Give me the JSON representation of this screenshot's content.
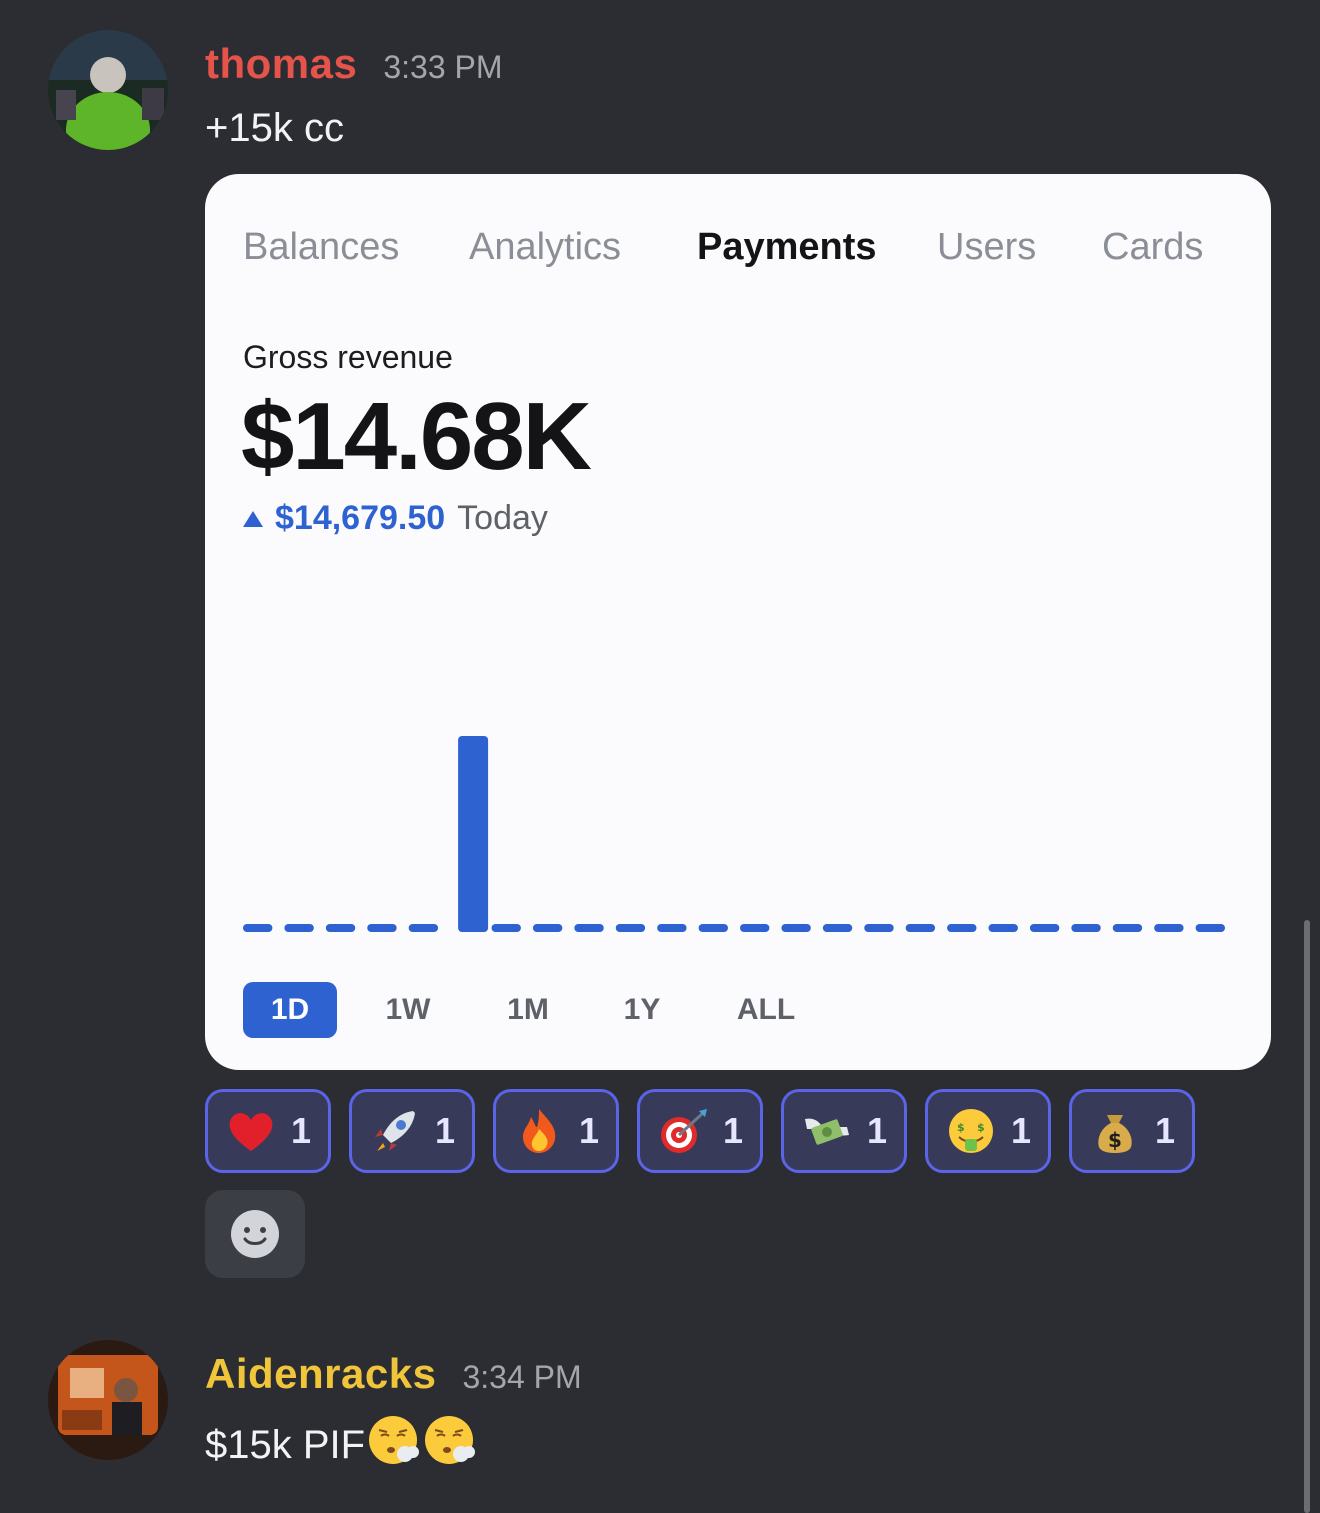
{
  "messages": [
    {
      "username": "thomas",
      "username_color": "#e5544a",
      "time": "3:33 PM",
      "text": "+15k cc",
      "attachment": {
        "tabs": [
          "Balances",
          "Analytics",
          "Payments",
          "Users",
          "Cards"
        ],
        "active_tab": "Payments",
        "metric_label": "Gross revenue",
        "metric_value": "$14.68K",
        "delta_value": "$14,679.50",
        "delta_period": "Today",
        "ranges": [
          "1D",
          "1W",
          "1M",
          "1Y",
          "ALL"
        ],
        "active_range": "1D"
      },
      "reactions": [
        {
          "emoji": "red-heart",
          "count": "1"
        },
        {
          "emoji": "rocket",
          "count": "1"
        },
        {
          "emoji": "fire",
          "count": "1"
        },
        {
          "emoji": "direct-hit",
          "count": "1"
        },
        {
          "emoji": "money-with-wings",
          "count": "1"
        },
        {
          "emoji": "money-mouth-face",
          "count": "1"
        },
        {
          "emoji": "money-bag",
          "count": "1"
        }
      ]
    },
    {
      "username": "Aidenracks",
      "username_color": "#f0c53a",
      "time": "3:34 PM",
      "text": "$15k PIF",
      "trailing_emojis": [
        "face-exhaling",
        "face-exhaling"
      ]
    }
  ],
  "chart_data": {
    "type": "bar",
    "series": [
      {
        "values": [
          0,
          0,
          0,
          0,
          0,
          14679.5,
          0,
          0,
          0,
          0,
          0,
          0,
          0,
          0,
          0,
          0,
          0,
          0,
          0,
          0,
          0,
          0,
          0,
          0
        ]
      }
    ],
    "bar_color": "#2f62d1"
  }
}
